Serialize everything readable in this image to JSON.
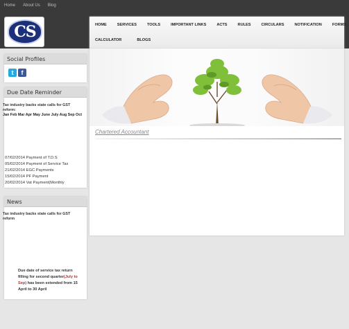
{
  "top_links": [
    "Home",
    "About Us",
    "Blog"
  ],
  "logo": {
    "text": "CS"
  },
  "nav": {
    "row1": [
      "HOME",
      "SERVICES",
      "TOOLS",
      "IMPORTANT LINKS",
      "ACTS",
      "RULES",
      "CIRCULARS",
      "NOTIFICATION",
      "FORMS"
    ],
    "row2": [
      "CALCULATOR",
      "BLOGS"
    ]
  },
  "ticker": "Chartered Accountant",
  "social": {
    "title": "Social Profiles",
    "icons": [
      "twitter-icon",
      "facebook-icon"
    ]
  },
  "due": {
    "title": "Due Date Reminder",
    "headline": "Tax industry backs state calls for GST reform:",
    "months": "Jan Feb Mar Apr May June July Aug Sep Oct",
    "payments": [
      "07/02/2014 Payment of T.D.S",
      "05/02/2014 Payment of Service Tax",
      "21/02/2014 EGC Payments",
      "15/02/2014 PF Payment",
      "20/02/2014 Vat Payment(Monthly"
    ]
  },
  "news": {
    "title": "News",
    "headline": "Tax industry backs state calls for GST reform",
    "note_pre": "Due date of service tax return filling for second quarter",
    "note_hl": "(July to Sep)",
    "note_post": " has been extended from 15 April to 30 April"
  },
  "colors": {
    "topbar": "#3a3a3a",
    "logo_blue": "#1b2f7a",
    "page_bg": "#e6e6e6"
  }
}
